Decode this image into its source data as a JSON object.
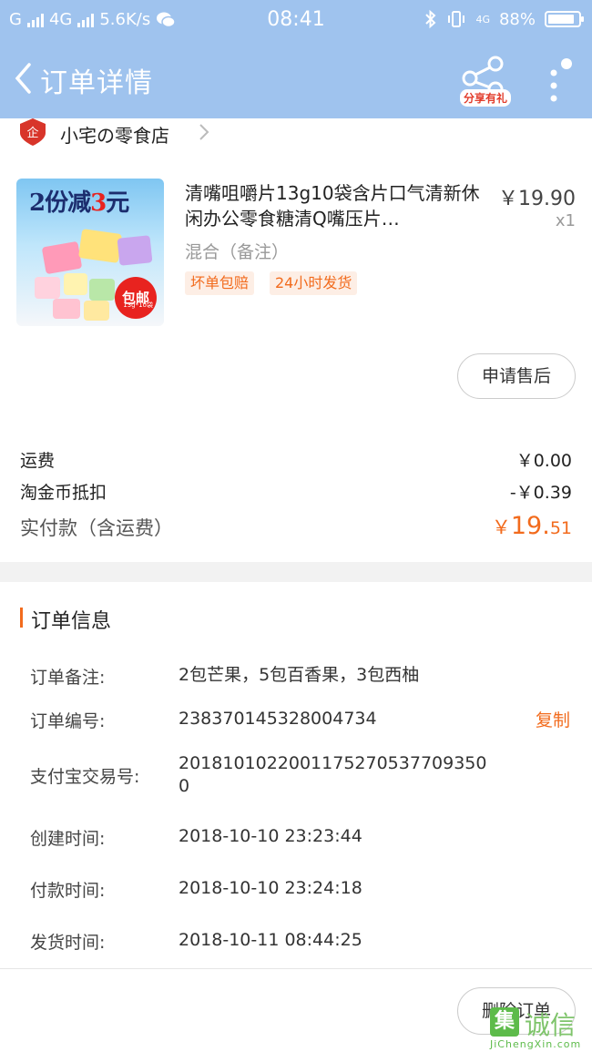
{
  "status_bar": {
    "carrier": "G",
    "network": "4G",
    "speed": "5.6K/s",
    "time": "08:41",
    "mini_network": "4G",
    "battery": "88%"
  },
  "nav": {
    "title": "订单详情",
    "share_label": "分享有礼"
  },
  "store": {
    "name": "小宅の零食店"
  },
  "product": {
    "promo_prefix": "2份减",
    "promo_num": "3",
    "promo_suffix": "元",
    "badge": "包邮",
    "badge_sub": "13g*10袋",
    "title": "清嘴咀嚼片13g10袋含片口气清新休闲办公零食糖清Q嘴压片…",
    "price": "￥19.90",
    "quantity": "x1",
    "variant": "混合（备注）",
    "tags": [
      "坏单包赔",
      "24小时发货"
    ]
  },
  "buttons": {
    "after_sale": "申请售后",
    "delete_order": "删除订单"
  },
  "costs": {
    "shipping_label": "运费",
    "shipping_value": "￥0.00",
    "coin_label": "淘金币抵扣",
    "coin_value": "-￥0.39",
    "paid_label": "实付款（含运费）",
    "paid_currency": "￥",
    "paid_int": "19.",
    "paid_cents": "51"
  },
  "order_info": {
    "title": "订单信息",
    "note_label": "订单备注:",
    "note_value": "2包芒果，5包百香果，3包西柚",
    "order_no_label": "订单编号:",
    "order_no_value": "238370145328004734",
    "copy_label": "复制",
    "alipay_label": "支付宝交易号:",
    "alipay_line1": "2018101022001175270537709350",
    "alipay_line2": "0",
    "created_label": "创建时间:",
    "created_value": "2018-10-10 23:23:44",
    "paid_time_label": "付款时间:",
    "paid_time_value": "2018-10-10 23:24:18",
    "shipped_label": "发货时间:",
    "shipped_value": "2018-10-11 08:44:25"
  },
  "watermark": {
    "box": "集",
    "text": "诚信",
    "url": "JiChengXin.com"
  },
  "colors": {
    "header_bg": "#9fc3ee",
    "accent": "#f26b1d",
    "store_icon": "#d8352a"
  }
}
